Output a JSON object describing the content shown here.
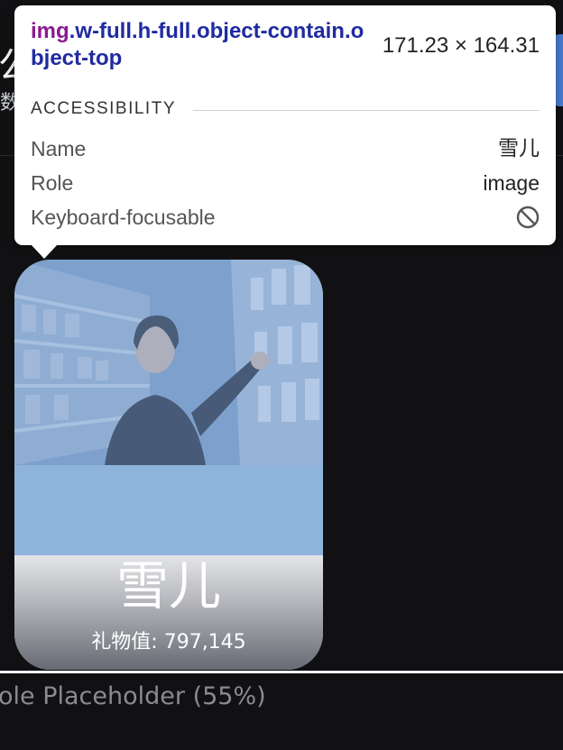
{
  "background_page": {
    "title_fragment": "公",
    "subtitle_fragment": "数",
    "placeholder_text": "ole Placeholder (55%)"
  },
  "card": {
    "image_alt": "雪儿",
    "name": "雪儿",
    "gift_value": "礼物值: 797,145"
  },
  "tooltip": {
    "selector_tag": "img",
    "selector_classes": ".w-full.h-full.object-contain.object-top",
    "size": "171.23 × 164.31",
    "section_title": "ACCESSIBILITY",
    "rows": [
      {
        "label": "Name",
        "value": "雪儿"
      },
      {
        "label": "Role",
        "value": "image"
      },
      {
        "label": "Keyboard-focusable",
        "icon": "not-allowed-icon"
      }
    ]
  },
  "colors": {
    "page_background": "#111113",
    "photo_tint": "#8fb4dc",
    "selector_tag_color": "#8a1a8f",
    "selector_class_color": "#1f2ba0"
  }
}
